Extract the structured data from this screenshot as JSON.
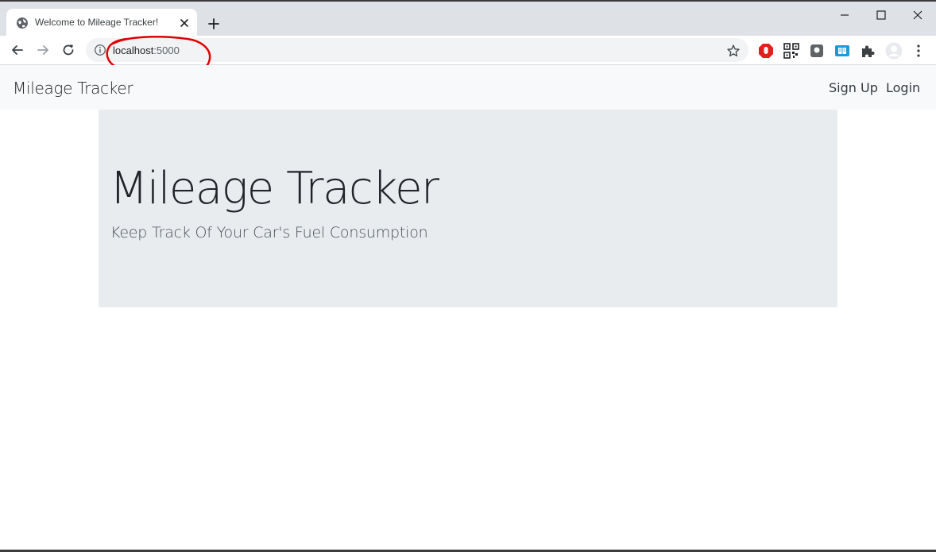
{
  "browser": {
    "tab": {
      "title": "Welcome to Mileage Tracker!",
      "favicon": "globe-icon"
    },
    "address_bar": {
      "host": "localhost",
      "port": ":5000"
    },
    "extensions": [
      "opera-adblock-icon",
      "qr-code-icon",
      "extension-square-icon",
      "reader-book-icon",
      "puzzle-icon",
      "profile-avatar-icon"
    ],
    "annotation_color": "#e00000"
  },
  "navbar": {
    "brand": "Mileage Tracker",
    "links": {
      "signup": "Sign Up",
      "login": "Login"
    }
  },
  "jumbotron": {
    "title": "Mileage Tracker",
    "lead": "Keep Track Of Your Car's Fuel Consumption"
  }
}
